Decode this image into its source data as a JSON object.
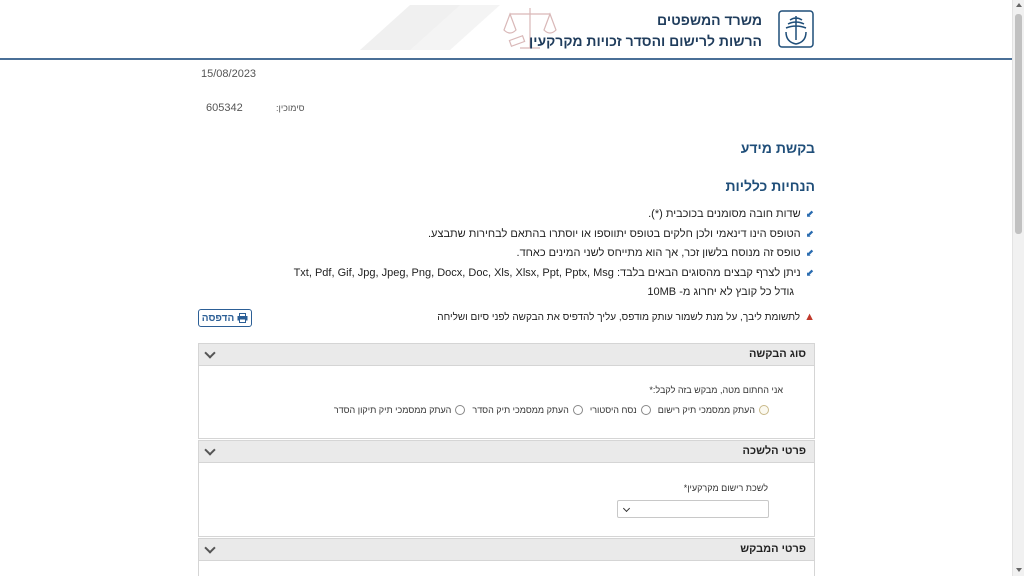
{
  "header": {
    "ministry_name": "משרד המשפטים",
    "authority_name": "הרשות לרישום והסדר זכויות מקרקעין"
  },
  "meta": {
    "date": "15/08/2023",
    "reference_label": "סימוכין:",
    "reference_value": "605342"
  },
  "page": {
    "title": "בקשת מידע",
    "guidelines_title": "הנחיות כלליות"
  },
  "guidelines": {
    "items": [
      "שדות חובה מסומנים בכוכבית (*).",
      "הטופס הינו דינאמי ולכן חלקים בטופס יתווספו או יוסתרו בהתאם לבחירות שתבצע.",
      "טופס זה מנוסח בלשון זכר, אך הוא מתייחס לשני המינים כאחד.",
      "ניתן לצרף קבצים מהסוגים הבאים בלבד: Txt, Pdf, Gif, Jpg, Jpeg, Png, Docx, Doc, Xls, Xlsx, Ppt, Pptx, Msg"
    ],
    "sub_note": "גודל כל קובץ לא יחרוג מ- 10MB"
  },
  "warning": {
    "text": "לתשומת ליבך, על מנת לשמור עותק מודפס, עליך להדפיס את הבקשה לפני סיום ושליחה"
  },
  "print_button": {
    "label": "הדפסה"
  },
  "sections": {
    "request_type": {
      "title": "סוג הבקשה",
      "label": "אני החתום מטה, מבקש בזה לקבל:*",
      "options": [
        "העתק ממסמכי תיק רישום",
        "נסח היסטורי",
        "העתק ממסמכי תיק הסדר",
        "העתק ממסמכי תיק תיקון הסדר"
      ]
    },
    "bureau": {
      "title": "פרטי הלשכה",
      "label": "לשכת רישום מקרקעין*",
      "value": ""
    },
    "requester": {
      "title": "פרטי המבקש"
    }
  },
  "colors": {
    "accent": "#1f4e79",
    "header_border": "#4a6f97",
    "warning": "#c0392b",
    "panel_header_bg": "#eaeaea"
  }
}
